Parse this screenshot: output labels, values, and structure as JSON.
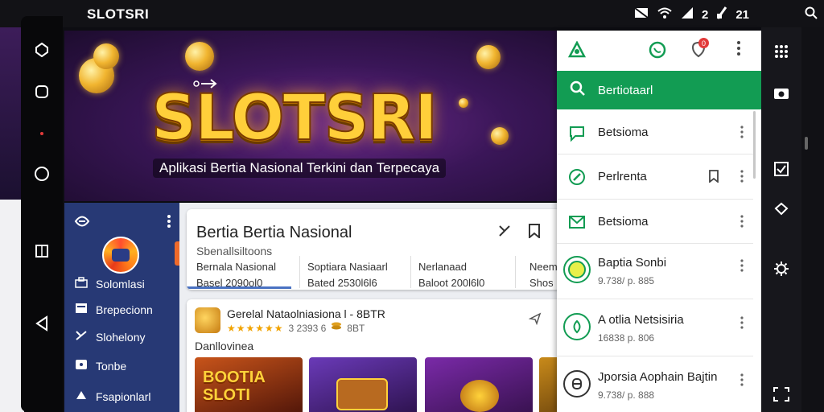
{
  "status_bar": {
    "title": "SLOTSRI",
    "time": "21",
    "signal_text": "2"
  },
  "hero": {
    "logo": "SLOTSRI",
    "subtitle": "Aplikasi Bertia Nasional Terkini dan Terpecaya"
  },
  "drawer": {
    "profile_name": "Solomlasi",
    "items": [
      {
        "label": "Brepecionn",
        "icon": "grid-icon"
      },
      {
        "label": "Slohelony",
        "icon": "tools-icon"
      },
      {
        "label": "Tonbe",
        "icon": "shield-icon"
      },
      {
        "label": "Fsapionlarl",
        "icon": "megaphone-icon"
      }
    ]
  },
  "news_card": {
    "title": "Bertia Bertia Nasional",
    "subtitle": "Sbenallsiltoons",
    "columns": [
      {
        "line1": "Bernala Nasional",
        "line2": "Basel 2090ol0"
      },
      {
        "line1": "Soptiara Nasiaarl",
        "line2": "Bated 2530l6l6"
      },
      {
        "line1": "Nerlanaad",
        "line2": "Baloot 200l6l0"
      },
      {
        "line1": "Neem",
        "line2": "Shos"
      }
    ]
  },
  "app_card": {
    "name": "Gerelal Nataolniasiona l - 8BTR",
    "rating_stars": "★★★★★★",
    "rating_count": "3 2393 6",
    "extra": "8BT",
    "section_label": "Danllovinea",
    "thumbs": [
      {
        "title": "BOOTIA SLOTI",
        "colors": [
          "#c8541a",
          "#4a1208"
        ]
      },
      {
        "title": "",
        "colors": [
          "#6a3ab8",
          "#2a1048"
        ]
      },
      {
        "title": "",
        "colors": [
          "#7a2aa8",
          "#34104a"
        ]
      },
      {
        "title": "",
        "colors": [
          "#c88a1a",
          "#4a2a08"
        ]
      }
    ]
  },
  "panel": {
    "search_label": "Bertiotaarl",
    "rows": [
      {
        "label": "Betsioma",
        "sub": ""
      },
      {
        "label": "Perlrenta",
        "sub": ""
      },
      {
        "label": "Betsioma",
        "sub": ""
      },
      {
        "label": "Baptia Sonbi",
        "sub": "9.738/ p. 885"
      },
      {
        "label": "A otlia Netsisiria",
        "sub": "16838 p. 806"
      },
      {
        "label": "Jporsia Aophain Bajtin",
        "sub": "9.738/ p. 888"
      }
    ],
    "badge_count": "0"
  },
  "colors": {
    "accent_green": "#129c53",
    "drawer_blue": "#273975"
  }
}
